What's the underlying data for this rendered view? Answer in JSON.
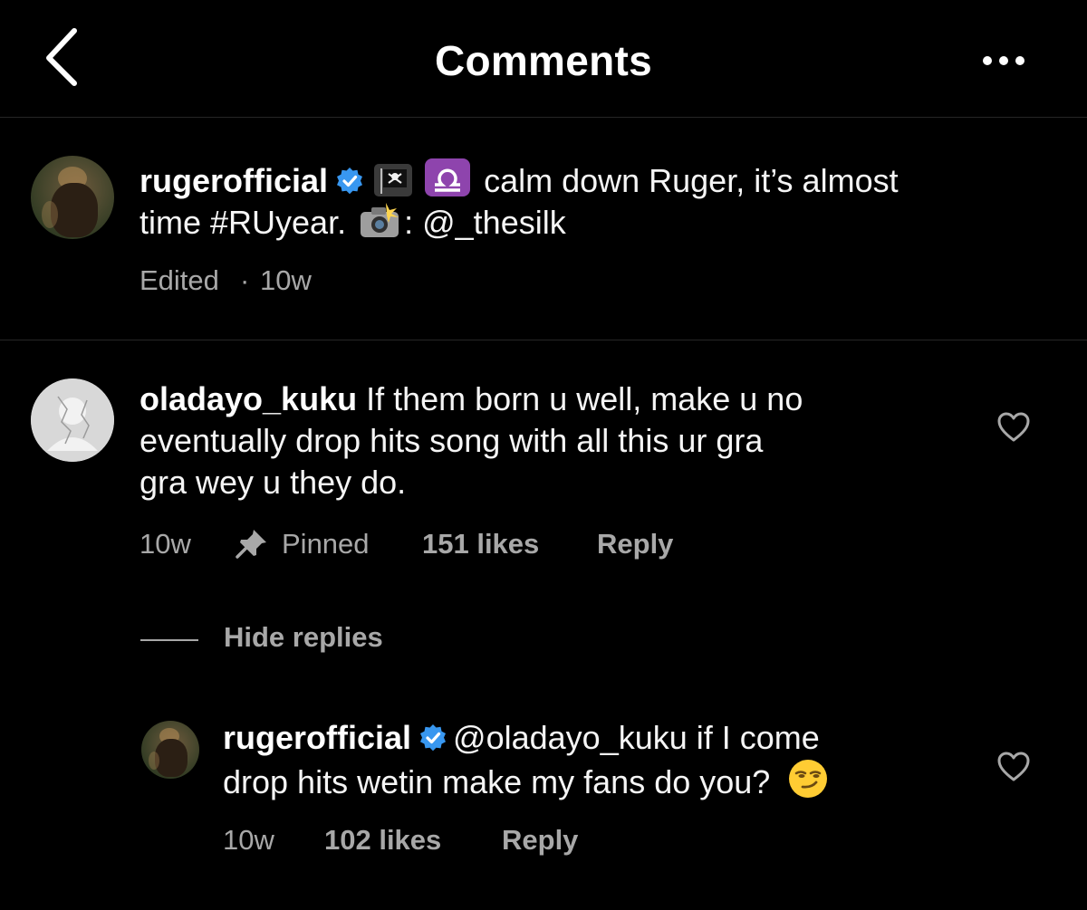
{
  "header": {
    "title": "Comments",
    "back_icon": "chevron-left-icon",
    "more_icon": "more-horizontal-icon"
  },
  "caption": {
    "username": "rugerofficial",
    "text_line1": "calm down Ruger, it’s almost",
    "text_line2_a": "time #RUyear.",
    "text_line2_b": ": @_thesilk",
    "flag_emoji": "🏴‍☠️",
    "libra_emoji": "♎",
    "camera_emoji": "📸",
    "edited": "Edited",
    "dot": "·",
    "time": "10w"
  },
  "comments": [
    {
      "username": "oladayo_kuku",
      "text_line1": "If them born u well, make u no",
      "text_line2": "eventually drop hits song with all this ur gra",
      "text_line3": "gra wey u they do.",
      "time": "10w",
      "pinned_label": "Pinned",
      "likes": "151 likes",
      "reply_label": "Reply"
    }
  ],
  "hide_replies_label": "Hide replies",
  "replies": [
    {
      "username": "rugerofficial",
      "text_line1": "@oladayo_kuku if I come",
      "text_line2": "drop hits wetin make my fans do you?",
      "emoji": "😏",
      "time": "10w",
      "likes": "102 likes",
      "reply_label": "Reply"
    }
  ],
  "colors": {
    "background": "#000000",
    "divider": "#262626",
    "secondary_text": "#a8a8a8",
    "verified_blue": "#3897f0",
    "libra_purple": "#8e44ad"
  }
}
